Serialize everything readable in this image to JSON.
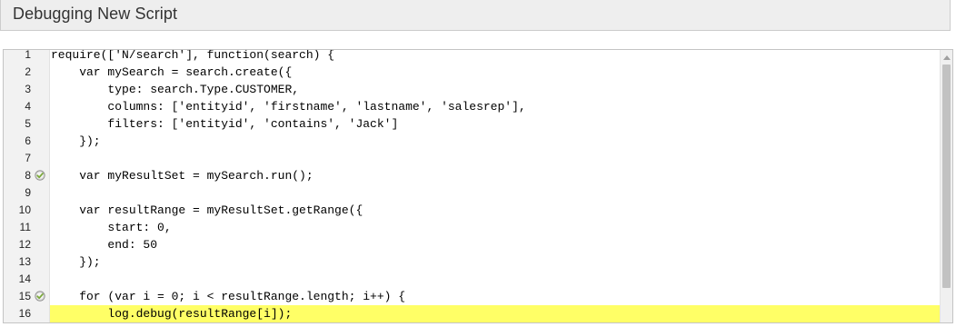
{
  "title": "Debugging New Script",
  "breakpoint_color": "#7aa83a",
  "highlight_color": "#ffff66",
  "lines": [
    {
      "num": "1",
      "code": "require(['N/search'], function(search) {",
      "breakpoint": false,
      "highlight": false
    },
    {
      "num": "2",
      "code": "    var mySearch = search.create({",
      "breakpoint": false,
      "highlight": false
    },
    {
      "num": "3",
      "code": "        type: search.Type.CUSTOMER,",
      "breakpoint": false,
      "highlight": false
    },
    {
      "num": "4",
      "code": "        columns: ['entityid', 'firstname', 'lastname', 'salesrep'],",
      "breakpoint": false,
      "highlight": false
    },
    {
      "num": "5",
      "code": "        filters: ['entityid', 'contains', 'Jack']",
      "breakpoint": false,
      "highlight": false
    },
    {
      "num": "6",
      "code": "    });",
      "breakpoint": false,
      "highlight": false
    },
    {
      "num": "7",
      "code": "",
      "breakpoint": false,
      "highlight": false
    },
    {
      "num": "8",
      "code": "    var myResultSet = mySearch.run();",
      "breakpoint": true,
      "highlight": false
    },
    {
      "num": "9",
      "code": "",
      "breakpoint": false,
      "highlight": false
    },
    {
      "num": "10",
      "code": "    var resultRange = myResultSet.getRange({",
      "breakpoint": false,
      "highlight": false
    },
    {
      "num": "11",
      "code": "        start: 0,",
      "breakpoint": false,
      "highlight": false
    },
    {
      "num": "12",
      "code": "        end: 50",
      "breakpoint": false,
      "highlight": false
    },
    {
      "num": "13",
      "code": "    });",
      "breakpoint": false,
      "highlight": false
    },
    {
      "num": "14",
      "code": "",
      "breakpoint": false,
      "highlight": false
    },
    {
      "num": "15",
      "code": "    for (var i = 0; i < resultRange.length; i++) {",
      "breakpoint": true,
      "highlight": false
    },
    {
      "num": "16",
      "code": "        log.debug(resultRange[i]);",
      "breakpoint": false,
      "highlight": true
    }
  ]
}
